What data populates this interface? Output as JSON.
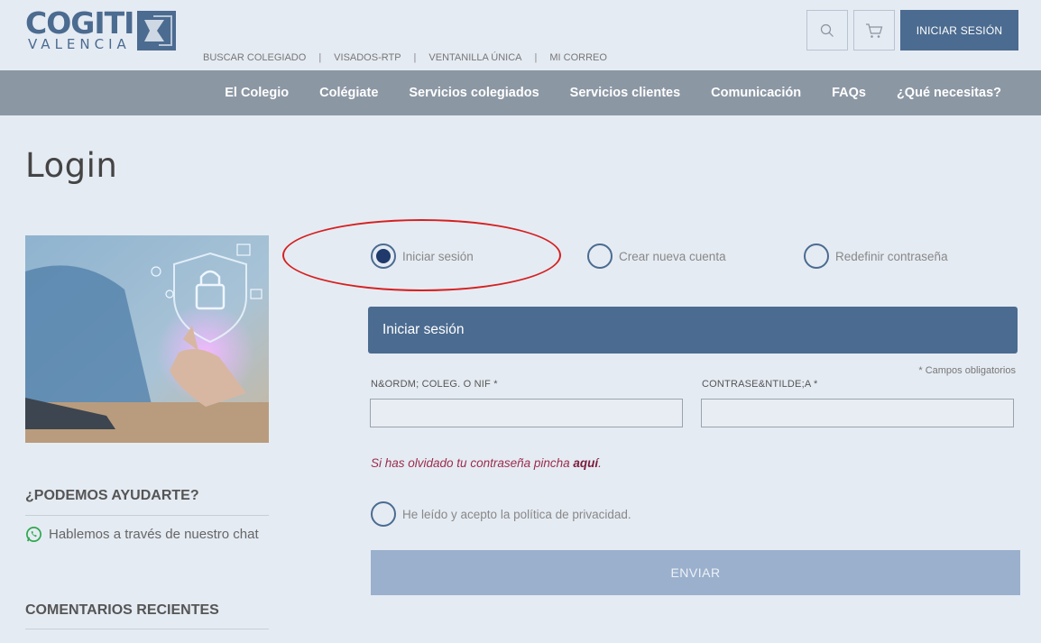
{
  "header": {
    "logo_main": "COGITI",
    "logo_sub": "VALENCIA",
    "top_links": [
      "BUSCAR COLEGIADO",
      "VISADOS-RTP",
      "VENTANILLA ÚNICA",
      "MI CORREO"
    ],
    "login_button": "INICIAR SESIÓN",
    "icons": [
      "search-icon",
      "cart-icon"
    ]
  },
  "nav": {
    "items": [
      "El Colegio",
      "Colégiate",
      "Servicios colegiados",
      "Servicios clientes",
      "Comunicación",
      "FAQs",
      "¿Qué necesitas?"
    ]
  },
  "page": {
    "title": "Login"
  },
  "sidebar": {
    "help_heading": "¿PODEMOS AYUDARTE?",
    "chat_text": "Hablemos a través de nuestro chat",
    "recent_heading": "COMENTARIOS RECIENTES"
  },
  "tabs": {
    "options": [
      "Iniciar sesión",
      "Crear nueva cuenta",
      "Redefinir contraseña"
    ],
    "selected": "Iniciar sesión"
  },
  "form": {
    "header": "Iniciar sesión",
    "required_note": "* Campos obligatorios",
    "user_label": "N&ORDM; COLEG. O NIF *",
    "user_value": "",
    "password_label": "CONTRASE&NTILDE;A *",
    "password_value": "",
    "forgot_text": "Si has olvidado tu contraseña pincha ",
    "forgot_link": "aquí",
    "forgot_end": ".",
    "privacy_text": "He leído y acepto la política de privacidad.",
    "submit_label": "ENVIAR"
  },
  "colors": {
    "accent": "#4b6b90",
    "nav_bg": "#8c97a4",
    "page_bg": "#e5ebf3",
    "highlight": "#d52020",
    "submit_bg": "#9ab0cd",
    "link": "#9b2d4c"
  }
}
